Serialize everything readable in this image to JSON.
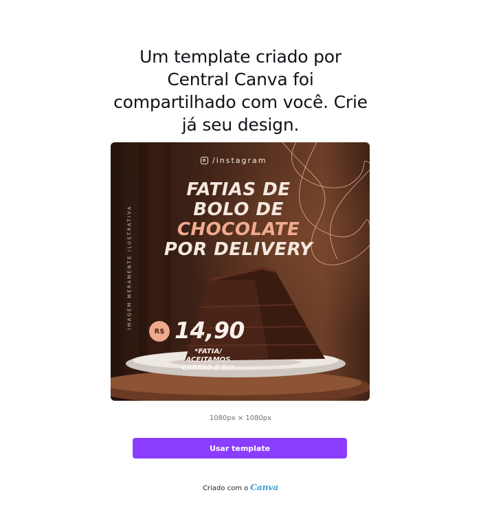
{
  "headline": {
    "line1": "Um template criado por",
    "line2": "Central Canva foi",
    "line3": "compartilhado com você. Crie",
    "line4": "já seu design."
  },
  "preview": {
    "instagram_label": "/instagram",
    "vertical_text": "IMAGEM MERAMENTE ILUSTRATIVA",
    "title": {
      "line1": "FATIAS DE",
      "line2": "BOLO DE",
      "line3": "CHOCOLATE",
      "line4": "POR DELIVERY"
    },
    "currency": "R$",
    "price": "14,90",
    "note": {
      "line1": "*FATIA/",
      "line2": "ACEITAMOS",
      "line3": "CARTÃO E PIX"
    },
    "colors": {
      "accent": "#f2ab90",
      "title": "#f4e8df",
      "background": "#3b2015"
    }
  },
  "dimensions_label": "1080px × 1080px",
  "cta": {
    "label": "Usar template",
    "color": "#8b3dff"
  },
  "footer": {
    "prefix": "Criado com o",
    "brand": "Canva"
  }
}
